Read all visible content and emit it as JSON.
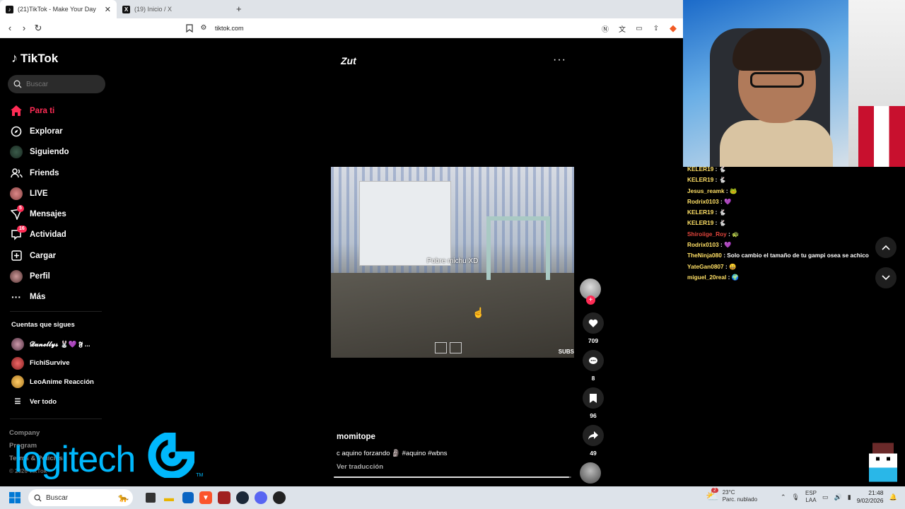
{
  "browser": {
    "tabs": [
      {
        "title": "(21)TikTok - Make Your Day",
        "active": true
      },
      {
        "title": "(19) Inicio / X",
        "active": false
      }
    ],
    "new_tab": "+",
    "url": "tiktok.com"
  },
  "sidebar": {
    "logo": "TikTok",
    "search_placeholder": "Buscar",
    "nav": [
      {
        "label": "Para ti",
        "icon": "home-icon",
        "active": true
      },
      {
        "label": "Explorar",
        "icon": "compass-icon"
      },
      {
        "label": "Siguiendo",
        "icon": "avatar-icon"
      },
      {
        "label": "Friends",
        "icon": "friends-icon"
      },
      {
        "label": "LIVE",
        "icon": "avatar-icon"
      },
      {
        "label": "Mensajes",
        "icon": "send-icon",
        "badge": "5"
      },
      {
        "label": "Actividad",
        "icon": "inbox-icon",
        "badge": "16"
      },
      {
        "label": "Cargar",
        "icon": "upload-icon"
      },
      {
        "label": "Perfil",
        "icon": "avatar-icon"
      },
      {
        "label": "Más",
        "icon": "more-icon"
      }
    ],
    "following_title": "Cuentas que sigues",
    "following": [
      {
        "name": "𝓓𝓪𝓷𝓮𝓵𝓵𝔂𝓼 🐰💜 𝕱 ..."
      },
      {
        "name": "FichiSurvive"
      },
      {
        "name": "LeoAnime Reacción"
      }
    ],
    "see_all": "Ver todo",
    "footer": [
      "Company",
      "Program",
      "Terms & Policies"
    ],
    "copyright": "© 2026 TikTok"
  },
  "feed": {
    "brand": "Zut",
    "more": "···",
    "video_caption": "Pobre michu XD",
    "video_corner": "SUBS",
    "author": "momitope",
    "description": "c aquino forzando 🗿 #aquino #wbns",
    "translate": "Ver traducción",
    "progress": 0.99,
    "actions": {
      "likes": "709",
      "comments": "8",
      "saves": "96",
      "shares": "49"
    }
  },
  "chat": [
    {
      "user": "KELER19",
      "msg": "🐇",
      "red": false
    },
    {
      "user": "KELER19",
      "msg": "🐇",
      "red": false
    },
    {
      "user": "Jesus_reamk",
      "msg": "🐸",
      "red": false
    },
    {
      "user": "Rodrix0103",
      "msg": "💜",
      "red": false
    },
    {
      "user": "KELER19",
      "msg": "🐇",
      "red": false
    },
    {
      "user": "KELER19",
      "msg": "🐇",
      "red": false
    },
    {
      "user": "Shiroiige_Roy",
      "msg": "🐢",
      "red": true
    },
    {
      "user": "Rodrix0103",
      "msg": "💜",
      "red": false
    },
    {
      "user": "TheNinja080",
      "msg": "Solo cambio el tamaño de tu gampi osea se achico",
      "red": false
    },
    {
      "user": "YateGan0807",
      "msg": "😄",
      "red": false
    },
    {
      "user": "miguel_20real",
      "msg": "🌍",
      "red": false
    }
  ],
  "overlay": {
    "sponsor": "logitech",
    "sponsor_tm": "TM"
  },
  "taskbar": {
    "search": "Buscar",
    "notification_count": "2",
    "temperature": "23°C",
    "weather": "Parc. nublado",
    "lang_top": "ESP",
    "lang_bottom": "LAA",
    "time": "21:48",
    "date": "9/02/2026"
  },
  "colors": {
    "accent": "#fe2c55",
    "chat_user": "#ffe066",
    "logitech": "#00b8fc"
  }
}
